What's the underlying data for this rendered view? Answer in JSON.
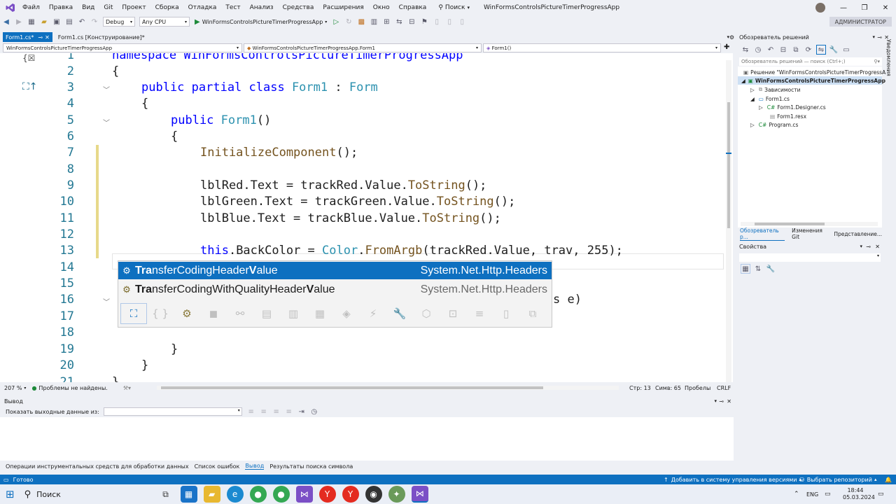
{
  "menu": [
    "Файл",
    "Правка",
    "Вид",
    "Git",
    "Проект",
    "Сборка",
    "Отладка",
    "Тест",
    "Анализ",
    "Средства",
    "Расширения",
    "Окно",
    "Справка"
  ],
  "search_label": "Поиск",
  "solution_title": "WinFormsControlsPictureTimerProgressApp",
  "toolbar": {
    "config": "Debug",
    "platform": "Any CPU",
    "run_target": "WinFormsControlsPictureTimerProgressApp",
    "admin": "АДМИНИСТРАТОР"
  },
  "editor_tabs": [
    {
      "label": "Form1.cs*",
      "active": true
    },
    {
      "label": "Form1.cs [Конструирование]*",
      "active": false
    }
  ],
  "navbar": {
    "project": "WinFormsControlsPictureTimerProgressApp",
    "class": "WinFormsControlsPictureTimerProgressApp.Form1",
    "member": "Form1()"
  },
  "code": {
    "line_numbers": [
      "1",
      "2",
      "3",
      "4",
      "5",
      "6",
      "7",
      "8",
      "9",
      "10",
      "11",
      "12",
      "13",
      "14",
      "15",
      "16",
      "17",
      "18",
      "19",
      "20",
      "21"
    ],
    "l0": "namespace WinFormsControlsPictureTimerProgressApp",
    "l2_kw": "public partial class ",
    "l2_ty": "Form1",
    "l2_pl": " : ",
    "l2_ty2": "Form",
    "l4_kw": "public ",
    "l4_ty": "Form1",
    "l4_pl": "()",
    "l6_mt": "InitializeComponent",
    "l6_pl": "();",
    "l8_pl": "lblRed.Text = trackRed.Value.",
    "l8_mt": "ToString",
    "l8_pl2": "();",
    "l9_pl": "lblGreen.Text = trackGreen.Value.",
    "l9_mt": "ToString",
    "l9_pl2": "();",
    "l10_pl": "lblBlue.Text = trackBlue.Value.",
    "l10_mt": "ToString",
    "l10_pl2": "();",
    "l12_kw": "this",
    "l12_pl": ".BackColor = ",
    "l12_ty": "Color",
    "l12_pl2": ".",
    "l12_mt": "FromArgb",
    "l12_pl3": "(trackRed.Value, trav, 255);",
    "l15_tail": "s e)",
    "brace_open": "{",
    "brace_close": "}"
  },
  "completion": {
    "items": [
      {
        "name": "TransferCodingHeaderValue",
        "namespace": "System.Net.Http.Headers",
        "selected": true
      },
      {
        "name": "TransferCodingWithQualityHeaderValue",
        "namespace": "System.Net.Http.Headers",
        "selected": false
      }
    ]
  },
  "editor_status": {
    "zoom": "207 %",
    "issues": "Проблемы не найдены.",
    "line": "Стр: 13",
    "col": "Симв: 65",
    "spaces": "Пробелы",
    "eol": "CRLF"
  },
  "output": {
    "title": "Вывод",
    "show_from": "Показать выходные данные из:"
  },
  "bottom_tabs": [
    "Операции инструментальных средств для обработки данных",
    "Список ошибок",
    "Вывод",
    "Результаты поиска символа"
  ],
  "solution_explorer": {
    "title": "Обозреватель решений",
    "search_placeholder": "Обозреватель решений — поиск (Ctrl+;)",
    "tree": [
      {
        "label": "Решение \"WinFormsControlsPictureTimerProgressA",
        "indent": 0
      },
      {
        "label": "WinFormsControlsPictureTimerProgressApp",
        "indent": 1
      },
      {
        "label": "Зависимости",
        "indent": 2
      },
      {
        "label": "Form1.cs",
        "indent": 2
      },
      {
        "label": "Form1.Designer.cs",
        "indent": 3
      },
      {
        "label": "Form1.resx",
        "indent": 3
      },
      {
        "label": "Program.cs",
        "indent": 2
      }
    ],
    "tabs": [
      "Обозреватель р...",
      "Изменения Git",
      "Представление..."
    ]
  },
  "properties": {
    "title": "Свойства"
  },
  "right_strip": "Уведомления",
  "vs_status": {
    "ready": "Готово",
    "add_vcs": "Добавить в систему управления версиями",
    "select_repo": "Выбрать репозиторий"
  },
  "taskbar": {
    "search": "Поиск",
    "lang": "ENG",
    "time": "18:44",
    "date": "05.03.2024"
  },
  "colors": {
    "accent": "#0e70c0",
    "keyword": "#0000ff",
    "type": "#2b91af",
    "method": "#74531f"
  }
}
